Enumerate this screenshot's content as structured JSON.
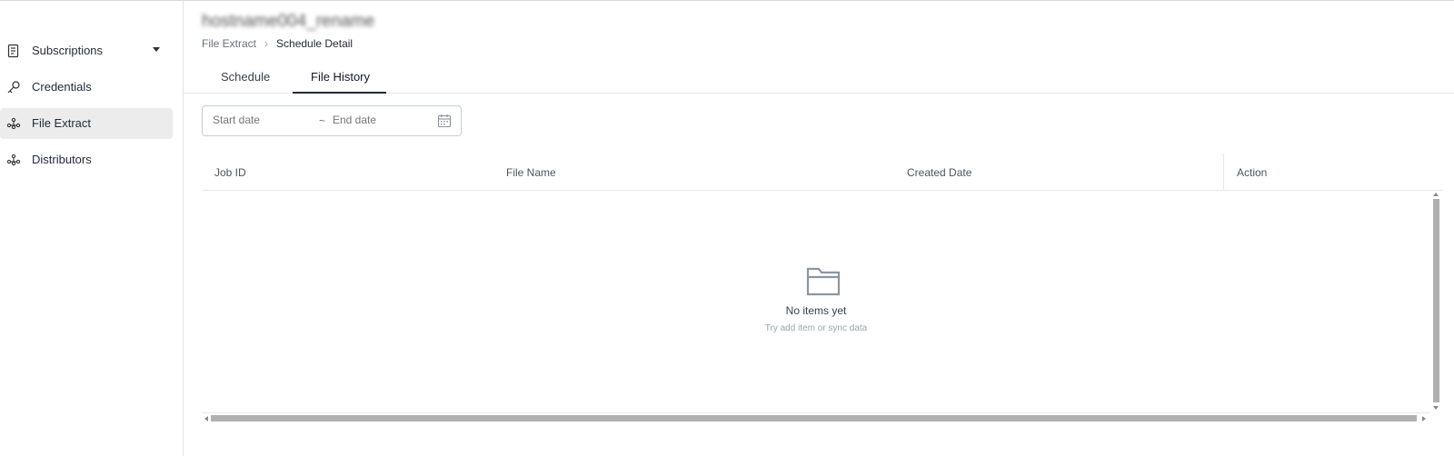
{
  "sidebar": {
    "items": [
      {
        "label": "Subscriptions",
        "icon": "document-icon",
        "has_dropdown": true,
        "active": false
      },
      {
        "label": "Credentials",
        "icon": "key-icon",
        "active": false
      },
      {
        "label": "File Extract",
        "icon": "network-icon",
        "active": true
      },
      {
        "label": "Distributors",
        "icon": "network-icon",
        "active": false
      }
    ]
  },
  "header": {
    "title": "hostname004_rename",
    "breadcrumb": {
      "parent": "File Extract",
      "current": "Schedule Detail"
    }
  },
  "tabs": [
    {
      "label": "Schedule",
      "active": false
    },
    {
      "label": "File History",
      "active": true
    }
  ],
  "date_range": {
    "start_placeholder": "Start date",
    "separator": "~",
    "end_placeholder": "End date"
  },
  "table": {
    "columns": [
      "Job ID",
      "File Name",
      "Created Date",
      "Action"
    ],
    "rows": []
  },
  "empty_state": {
    "title": "No items yet",
    "subtitle": "Try add item or sync data"
  },
  "colors": {
    "active_bg": "#ececec",
    "border": "#e5e7eb",
    "icon_gray": "#8b96a3"
  }
}
